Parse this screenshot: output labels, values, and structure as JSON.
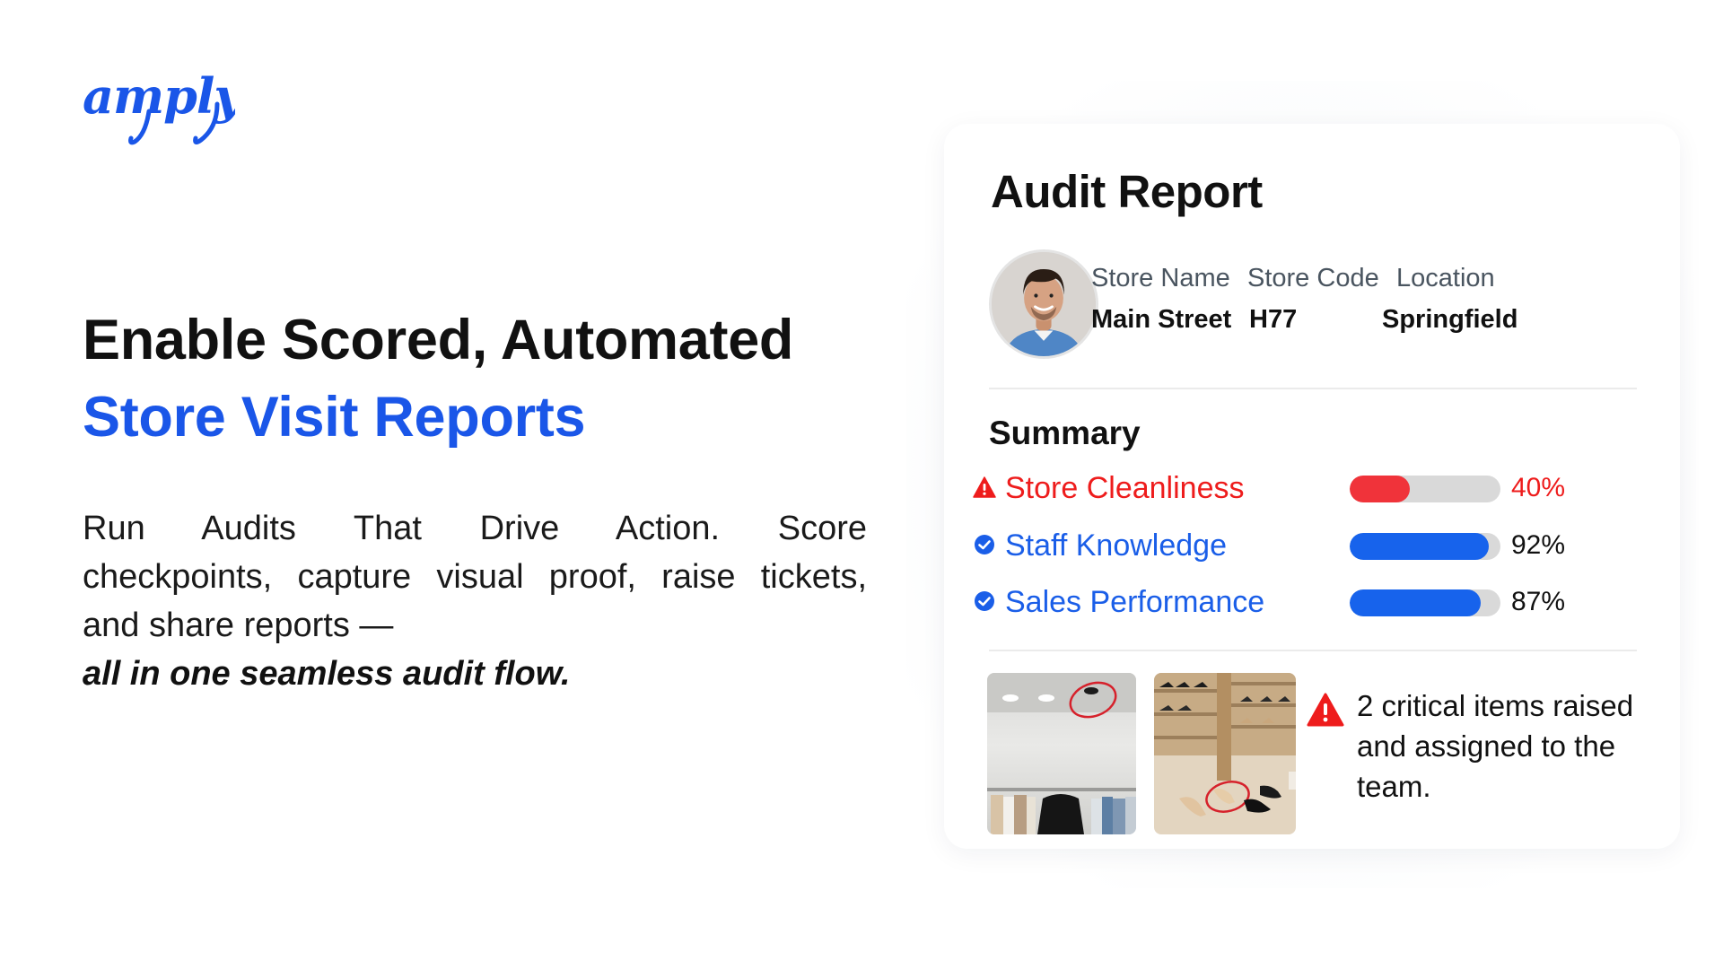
{
  "brand": {
    "logo_text": "amply",
    "accent_color": "#1a56e8"
  },
  "hero": {
    "title_line1": "Enable Scored, Automated",
    "title_line2": "Store Visit Reports",
    "body_line1": "Run Audits That Drive Action. Score",
    "body_line2": "checkpoints, capture visual proof, raise tickets,",
    "body_line3": "and share reports —",
    "body_emphasis": "all in one seamless audit flow."
  },
  "report": {
    "title": "Audit Report",
    "avatar_icon": "person-avatar",
    "store_name_label": "Store Name",
    "store_name_value": "Main Street",
    "store_code_label": "Store Code",
    "store_code_value": "H77",
    "location_label": "Location",
    "location_value": "Springfield",
    "summary_title": "Summary",
    "metrics": [
      {
        "name": "Store Cleanliness",
        "value_text": "40%",
        "fraction": 0.4,
        "status": "warning",
        "icon": "warning-icon",
        "label_color": "#ee1c1c",
        "fill_color": "#f0333a",
        "value_color": "#ee1c1c"
      },
      {
        "name": "Staff Knowledge",
        "value_text": "92%",
        "fraction": 0.92,
        "status": "ok",
        "icon": "check-circle-icon",
        "label_color": "#1a5ee8",
        "fill_color": "#1763ec",
        "value_color": "#111111"
      },
      {
        "name": "Sales Performance",
        "value_text": "87%",
        "fraction": 0.87,
        "status": "ok",
        "icon": "check-circle-icon",
        "label_color": "#1a5ee8",
        "fill_color": "#1763ec",
        "value_color": "#111111"
      }
    ],
    "evidence_photos": [
      "ceiling-light-photo",
      "shoe-display-photo"
    ],
    "alert_icon": "warning-icon",
    "alert_text": "2 critical items raised and assigned to the team."
  }
}
